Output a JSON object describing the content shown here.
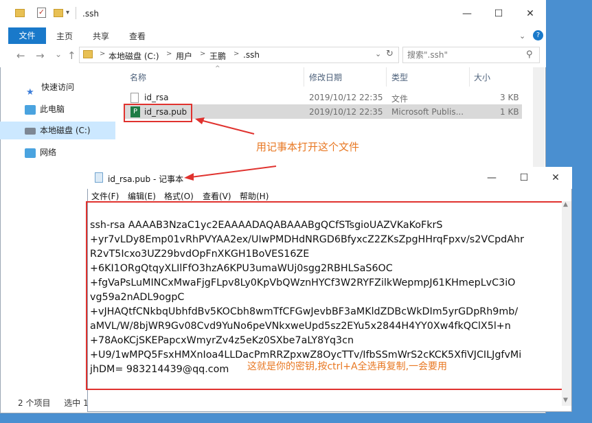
{
  "explorer": {
    "title": ".ssh",
    "window_buttons": [
      "—",
      "☐",
      "✕"
    ],
    "ribbon_tabs": [
      "文件",
      "主页",
      "共享",
      "查看"
    ],
    "help_icon": "?",
    "nav_arrows": [
      "←",
      "→",
      "⌄",
      "↑"
    ],
    "breadcrumb": [
      "本地磁盘 (C:)",
      "用户",
      "王鹏",
      ".ssh"
    ],
    "search_placeholder": "搜索\".ssh\"",
    "nav_items": [
      {
        "label": "快速访问",
        "icon": "star-icon",
        "color": "#3c7dd9"
      },
      {
        "label": "此电脑",
        "icon": "computer-icon",
        "color": "#4aa3df"
      },
      {
        "label": "本地磁盘 (C:)",
        "icon": "drive-icon",
        "color": "#7d8794"
      },
      {
        "label": "网络",
        "icon": "network-icon",
        "color": "#4aa3df"
      }
    ],
    "columns": [
      "名称",
      "修改日期",
      "类型",
      "大小"
    ],
    "files": [
      {
        "name": "id_rsa",
        "date": "2019/10/12 22:35",
        "type": "文件",
        "size": "3 KB"
      },
      {
        "name": "id_rsa.pub",
        "date": "2019/10/12 22:35",
        "type": "Microsoft Publis...",
        "size": "1 KB"
      }
    ],
    "status_count": "2 个项目",
    "status_selected": "选中 1"
  },
  "annotations": {
    "open_with_notepad": "用记事本打开这个文件",
    "copy_hint": "这就是你的密钥,按ctrl+A全选再复制,一会要用"
  },
  "notepad": {
    "title": "id_rsa.pub - 记事本",
    "window_buttons": [
      "—",
      "☐",
      "✕"
    ],
    "menu": [
      "文件(F)",
      "编辑(E)",
      "格式(O)",
      "查看(V)",
      "帮助(H)"
    ],
    "content_lines": [
      "ssh-rsa AAAAB3NzaC1yc2EAAAADAQABAAABgQCfSTsgioUAZVKaKoFkrS",
      "+yr7vLDy8Emp01vRhPVYAA2ex/UIwPMDHdNRGD6BfyxcZ2ZKsZpgHHrqFpxv/s2VCpdAhr",
      "R2vT5Icxo3UZ29bvdOpFnXKGH1BoVES16ZE",
      "+6KI1ORgQtqyXLIlFfO3hzA6KPU3umaWUj0sgg2RBHLSaS6OC",
      "+fgVaPsLuMINCxMwaFjgFLpv8Ly0KpVbQWznHYCf3W2RYFZilkWepmpJ61KHmepLvC3iO",
      "vg59a2nADL9ogpC",
      "+vJHAQtfCNkbqUbhfdBv5KOCbh8wmTfCFGwJevbBF3aMKldZDBcWkDIm5yrGDpRh9mb/",
      "aMVL/W/8bjWR9Gv08Cvd9YuNo6peVNkxweUpd5sz2EYu5x2844H4YY0Xw4fkQClX5l+n",
      "+78AoKCjSKEPapcxWmyrZv4z5eKz0SXbe7aLY8Yq3cn",
      "+U9/1wMPQ5FsxHMXnIoa4LLDacPmRRZpxwZ8OycTTv/IfbSSmWrS2cKCK5XfiVJCILJgfvMi",
      "jhDM= 983214439@qq.com"
    ]
  },
  "colors": {
    "accent": "#1979ca",
    "annotation": "#e87823",
    "highlight_box": "#e0322e"
  }
}
